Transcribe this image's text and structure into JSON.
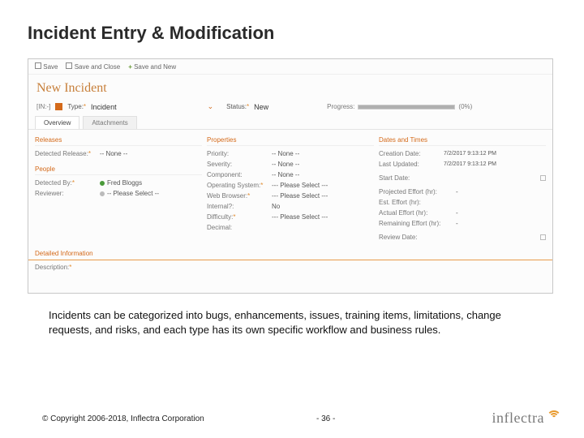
{
  "slide": {
    "title": "Incident Entry & Modification",
    "body": "Incidents can be categorized into bugs, enhancements, issues, training items, limitations, change requests, and risks, and each type has its own specific workflow and business rules.",
    "copyright": "© Copyright 2006-2018, Inflectra Corporation",
    "page": "- 36 -",
    "brand": "inflectra"
  },
  "app": {
    "toolbar": {
      "save": "Save",
      "save_close": "Save and Close",
      "save_new": "Save and New"
    },
    "page_heading": "New Incident",
    "header": {
      "id_token": "[IN:-]",
      "type_label": "Type:",
      "type_value": "Incident",
      "status_label": "Status:",
      "status_value": "New",
      "progress_label": "Progress:",
      "progress_value": "(0%)"
    },
    "tabs": {
      "overview": "Overview",
      "attachments": "Attachments"
    },
    "sections": {
      "releases": "Releases",
      "people": "People",
      "properties": "Properties",
      "dates": "Dates and Times",
      "detailed": "Detailed Information"
    },
    "fields": {
      "detected_release": {
        "label": "Detected Release:",
        "value": "-- None --"
      },
      "detected_by": {
        "label": "Detected By:",
        "value": "Fred Bloggs"
      },
      "reviewer": {
        "label": "Reviewer:",
        "value": "-- Please Select --"
      },
      "priority": {
        "label": "Priority:",
        "value": "-- None --"
      },
      "severity": {
        "label": "Severity:",
        "value": "-- None --"
      },
      "component": {
        "label": "Component:",
        "value": "-- None --"
      },
      "os": {
        "label": "Operating System:",
        "value": "--- Please Select ---"
      },
      "browser": {
        "label": "Web Browser:",
        "value": "--- Please Select ---"
      },
      "internal": {
        "label": "Internal?:",
        "value": "No"
      },
      "difficulty": {
        "label": "Difficulty:",
        "value": "--- Please Select ---"
      },
      "decimal": {
        "label": "Decimal:",
        "value": ""
      },
      "creation_date": {
        "label": "Creation Date:",
        "value": "7/2/2017 9:13:12 PM"
      },
      "last_updated": {
        "label": "Last Updated:",
        "value": "7/2/2017 9:13:12 PM"
      },
      "start_date": {
        "label": "Start Date:",
        "value": ""
      },
      "projected_effort": {
        "label": "Projected Effort (hr):",
        "value": "-"
      },
      "est_effort": {
        "label": "Est. Effort (hr):",
        "value": ""
      },
      "actual_effort": {
        "label": "Actual Effort (hr):",
        "value": "-"
      },
      "remaining_effort": {
        "label": "Remaining Effort (hr):",
        "value": "-"
      },
      "review_date": {
        "label": "Review Date:",
        "value": ""
      },
      "description": {
        "label": "Description:"
      }
    }
  }
}
